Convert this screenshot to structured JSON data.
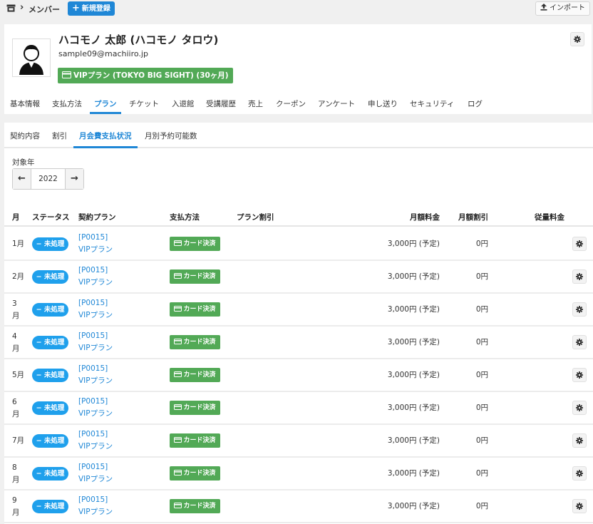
{
  "header": {
    "breadcrumb": "メンバー",
    "new_button": "新規登録",
    "import_button": "インポート"
  },
  "member": {
    "name": "ハコモノ 太郎 (ハコモノ タロウ)",
    "email": "sample09@machiiro.jp",
    "plan_badge": "VIPプラン (TOKYO BIG SIGHT) (30ヶ月)"
  },
  "main_tabs": [
    {
      "label": "基本情報"
    },
    {
      "label": "支払方法"
    },
    {
      "label": "プラン"
    },
    {
      "label": "チケット"
    },
    {
      "label": "入退館"
    },
    {
      "label": "受講履歴"
    },
    {
      "label": "売上"
    },
    {
      "label": "クーポン"
    },
    {
      "label": "アンケート"
    },
    {
      "label": "申し送り"
    },
    {
      "label": "セキュリティ"
    },
    {
      "label": "ログ"
    }
  ],
  "active_main_tab": "プラン",
  "sub_tabs": [
    {
      "label": "契約内容"
    },
    {
      "label": "割引"
    },
    {
      "label": "月会費支払状況"
    },
    {
      "label": "月別予約可能数"
    }
  ],
  "active_sub_tab": "月会費支払状況",
  "year_filter": {
    "label": "対象年",
    "value": "2022"
  },
  "table": {
    "headers": {
      "month": "月",
      "status": "ステータス",
      "plan": "契約プラン",
      "payment": "支払方法",
      "plan_discount": "プラン割引",
      "monthly_fee": "月額料金",
      "monthly_discount": "月額割引",
      "usage_fee": "従量料金"
    },
    "rows": [
      {
        "month": "1月",
        "status": "未処理",
        "plan_code": "[P0015]",
        "plan_name": "VIPプラン",
        "payment": "カード決済",
        "fee": "3,000円 (予定)",
        "discount": "0円"
      },
      {
        "month": "2月",
        "status": "未処理",
        "plan_code": "[P0015]",
        "plan_name": "VIPプラン",
        "payment": "カード決済",
        "fee": "3,000円 (予定)",
        "discount": "0円"
      },
      {
        "month": "3月",
        "status": "未処理",
        "plan_code": "[P0015]",
        "plan_name": "VIPプラン",
        "payment": "カード決済",
        "fee": "3,000円 (予定)",
        "discount": "0円"
      },
      {
        "month": "4月",
        "status": "未処理",
        "plan_code": "[P0015]",
        "plan_name": "VIPプラン",
        "payment": "カード決済",
        "fee": "3,000円 (予定)",
        "discount": "0円"
      },
      {
        "month": "5月",
        "status": "未処理",
        "plan_code": "[P0015]",
        "plan_name": "VIPプラン",
        "payment": "カード決済",
        "fee": "3,000円 (予定)",
        "discount": "0円"
      },
      {
        "month": "6月",
        "status": "未処理",
        "plan_code": "[P0015]",
        "plan_name": "VIPプラン",
        "payment": "カード決済",
        "fee": "3,000円 (予定)",
        "discount": "0円"
      },
      {
        "month": "7月",
        "status": "未処理",
        "plan_code": "[P0015]",
        "plan_name": "VIPプラン",
        "payment": "カード決済",
        "fee": "3,000円 (予定)",
        "discount": "0円"
      },
      {
        "month": "8月",
        "status": "未処理",
        "plan_code": "[P0015]",
        "plan_name": "VIPプラン",
        "payment": "カード決済",
        "fee": "3,000円 (予定)",
        "discount": "0円"
      },
      {
        "month": "9月",
        "status": "未処理",
        "plan_code": "[P0015]",
        "plan_name": "VIPプラン",
        "payment": "カード決済",
        "fee": "3,000円 (予定)",
        "discount": "0円"
      }
    ]
  },
  "colors": {
    "accent": "#1f87d6",
    "status_badge": "#1fa0ec",
    "payment_badge": "#52a956",
    "plan_badge": "#52a956"
  },
  "icons": {
    "store": "store-icon",
    "chevron": "chevron-right-icon",
    "plus": "plus-icon",
    "upload": "upload-icon",
    "card": "credit-card-icon",
    "gear": "gear-icon",
    "prev": "arrow-left-icon",
    "next": "arrow-right-icon",
    "minus": "minus-icon"
  }
}
